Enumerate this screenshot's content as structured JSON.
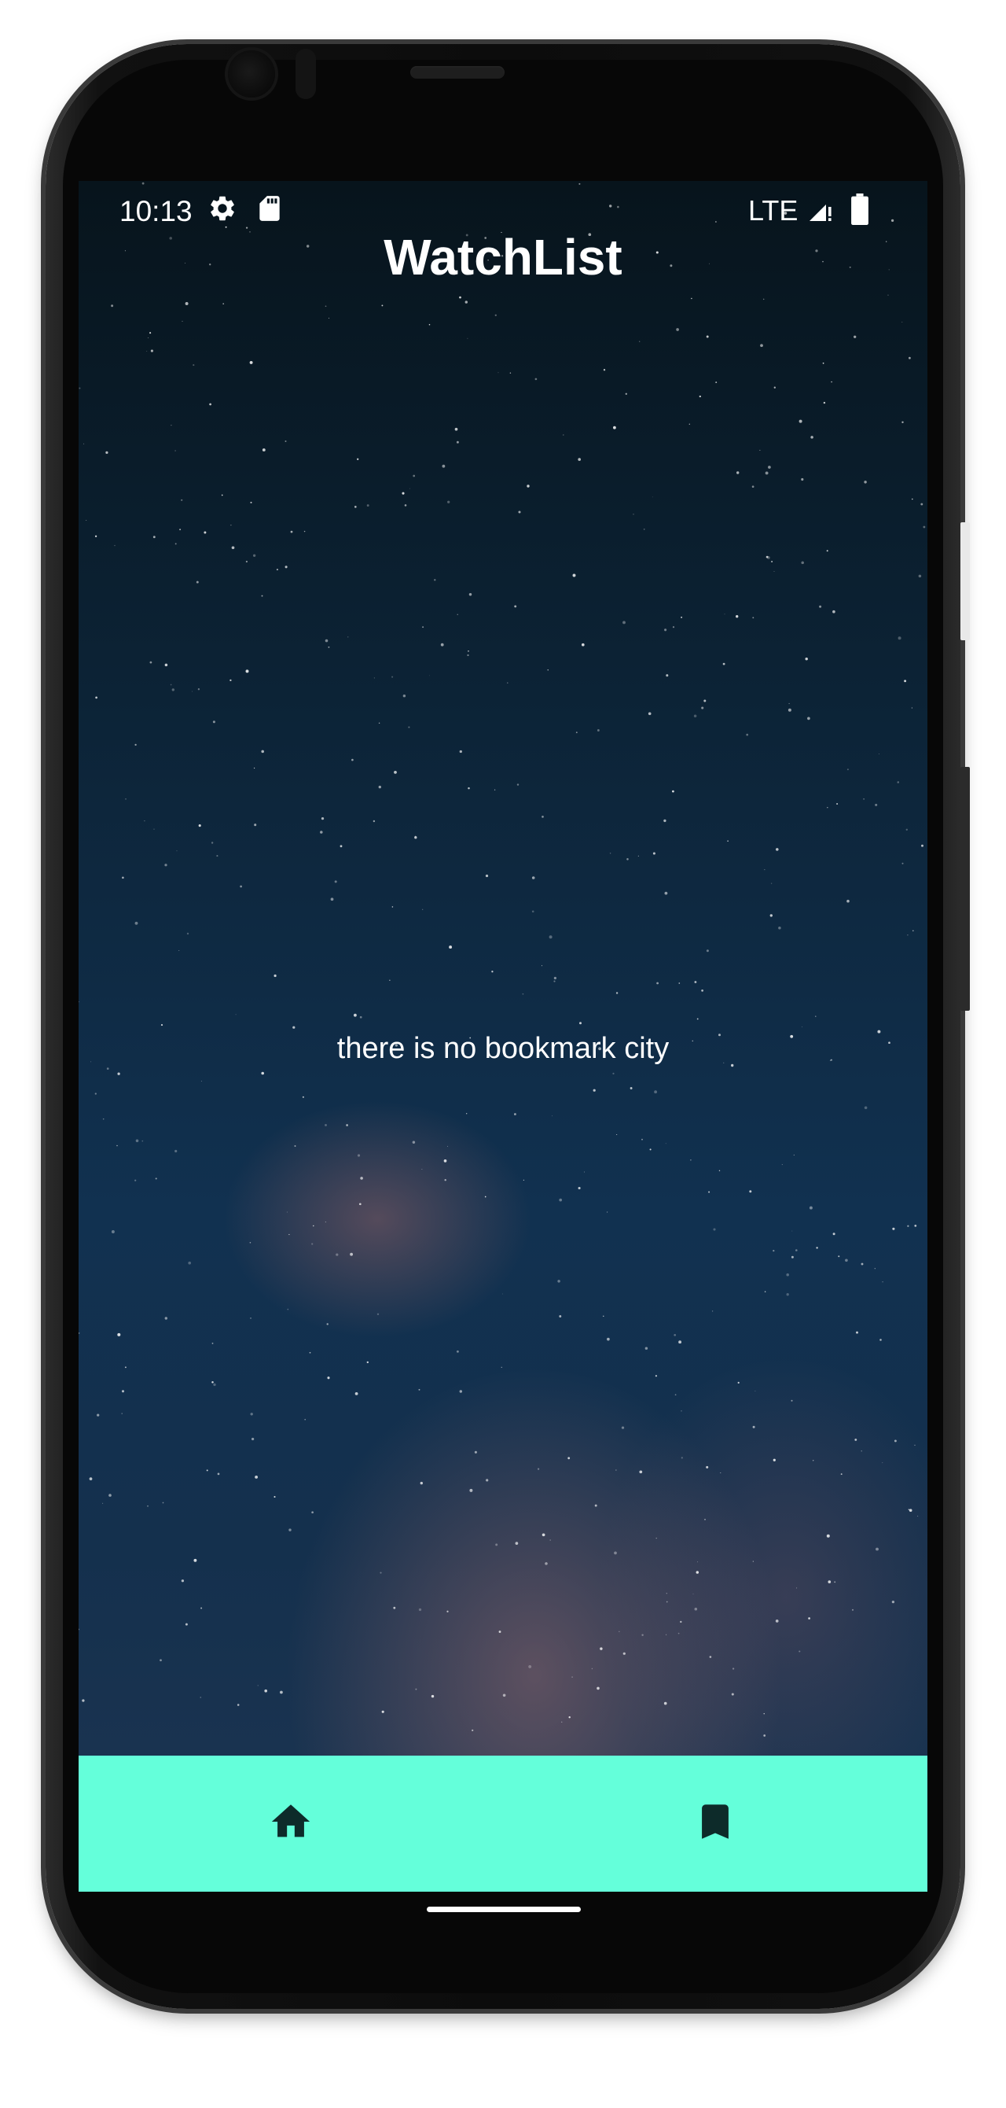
{
  "status_bar": {
    "time": "10:13",
    "network": "LTE",
    "icons": [
      "gear-icon",
      "sd-card-icon",
      "signal-icon",
      "battery-icon"
    ]
  },
  "app": {
    "title": "WatchList",
    "empty_message": "there is no bookmark city"
  },
  "bottom_nav": {
    "background_color": "#64FFDA",
    "items": [
      {
        "icon": "home-icon"
      },
      {
        "icon": "bookmark-icon"
      }
    ]
  }
}
